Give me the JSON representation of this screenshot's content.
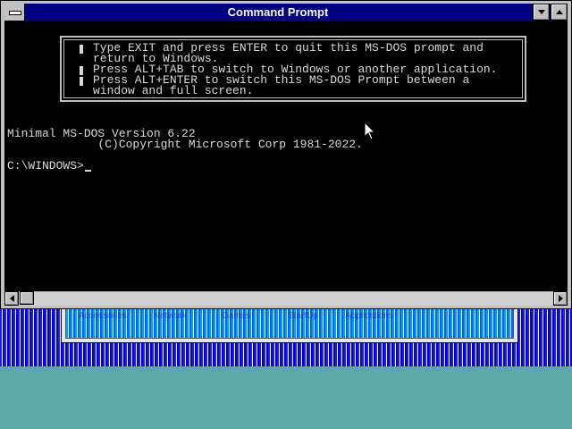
{
  "window": {
    "title": "Command Prompt"
  },
  "notice": {
    "lines": [
      "Type EXIT and press ENTER to quit this MS-DOS prompt and",
      "return to Windows.",
      "Press ALT+TAB to switch to Windows or another application.",
      "Press ALT+ENTER to switch this MS-DOS Prompt between a",
      "window and full screen."
    ]
  },
  "terminal": {
    "version_line": "Minimal MS-DOS Version 6.22",
    "copyright_line": "             (C)Copyright Microsoft Corp 1981-2022.",
    "prompt": "C:\\WINDOWS>"
  },
  "background_group": {
    "labels": [
      "Accessories",
      "Network",
      "Games",
      "StartUp",
      "Applications"
    ]
  },
  "colors": {
    "titlebar": "#000080",
    "terminal_bg": "#000000",
    "terminal_fg": "#d8d8d8",
    "desktop": "#5fa8a8"
  },
  "icons": {
    "system_menu": "system-menu-icon",
    "minimize": "minimize-arrow-icon",
    "maximize": "maximize-arrow-icon",
    "scroll_left": "scroll-left-arrow-icon",
    "scroll_right": "scroll-right-arrow-icon",
    "pointer": "mouse-pointer-icon"
  }
}
